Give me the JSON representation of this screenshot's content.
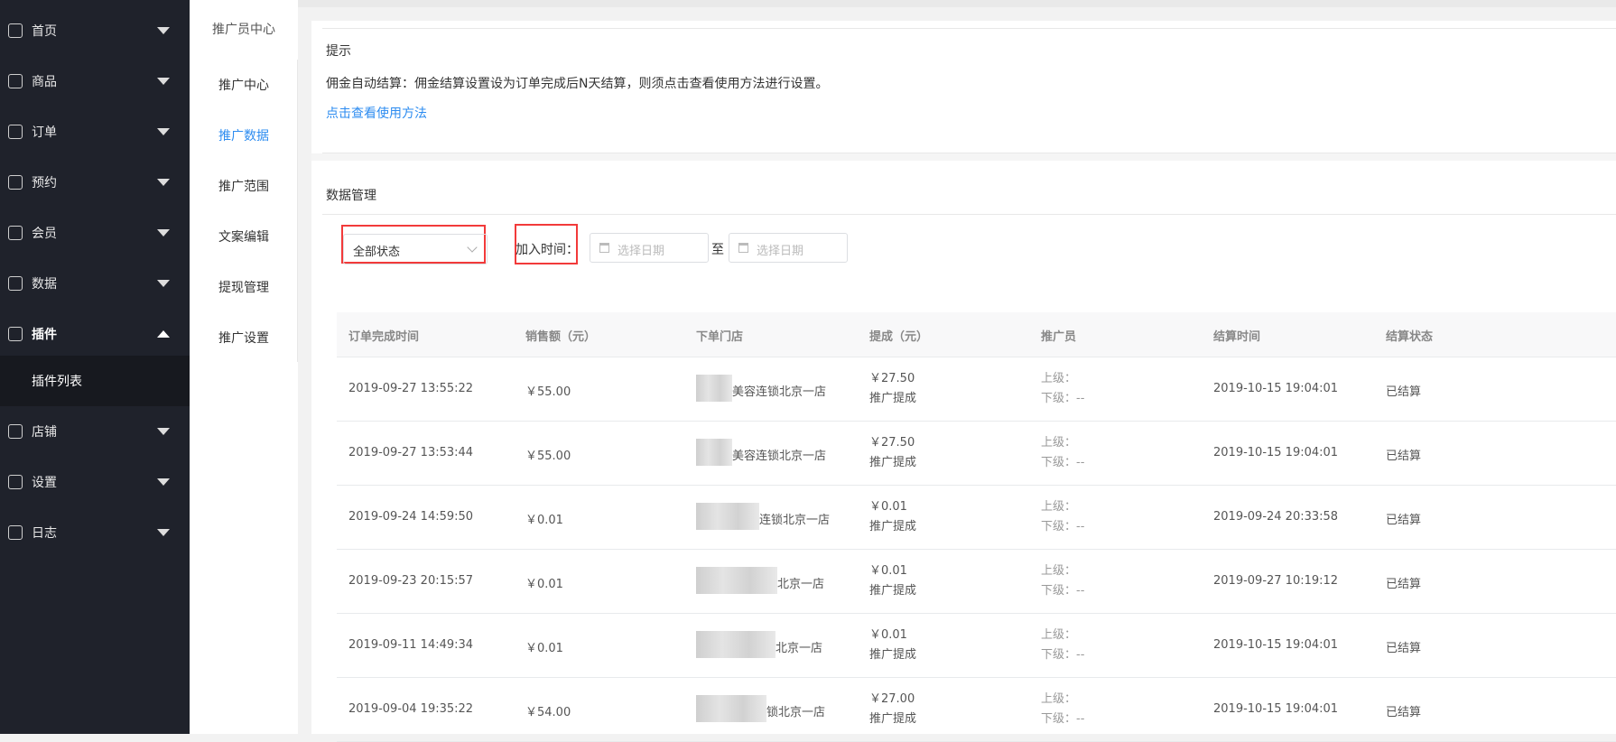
{
  "sidebar": {
    "items": [
      {
        "label": "首页",
        "icon": "dashboard-icon"
      },
      {
        "label": "商品",
        "icon": "document-icon"
      },
      {
        "label": "订单",
        "icon": "clipboard-icon"
      },
      {
        "label": "预约",
        "icon": "home-icon"
      },
      {
        "label": "会员",
        "icon": "user-icon"
      },
      {
        "label": "数据",
        "icon": "flag-icon"
      },
      {
        "label": "插件",
        "icon": "cube-icon"
      },
      {
        "label": "店铺",
        "icon": "flag-icon"
      },
      {
        "label": "设置",
        "icon": "gear-icon"
      },
      {
        "label": "日志",
        "icon": "clipboard-icon"
      }
    ],
    "sub_item": "插件列表"
  },
  "subnav": {
    "title": "推广员中心",
    "items": [
      "推广中心",
      "推广数据",
      "推广范围",
      "文案编辑",
      "提现管理",
      "推广设置"
    ],
    "active": "推广数据"
  },
  "hint": {
    "title": "提示",
    "text": "佣金自动结算：佣金结算设置设为订单完成后N天结算，则须点击查看使用方法进行设置。",
    "link": "点击查看使用方法"
  },
  "data_mgmt": {
    "title": "数据管理",
    "status_select": "全部状态",
    "join_time_label": "加入时间：",
    "date_placeholder": "选择日期",
    "to": "至"
  },
  "table": {
    "headers": [
      "订单完成时间",
      "销售额（元）",
      "下单门店",
      "提成（元）",
      "推广员",
      "结算时间",
      "结算状态"
    ],
    "rows": [
      {
        "time": "2019-09-27 13:55:22",
        "sales": "￥55.00",
        "store": "美容连锁北京一店",
        "commission": "￥27.50",
        "commission_type": "推广提成",
        "upper": "上级：",
        "lower": "下级：--",
        "settle_time": "2019-10-15 19:04:01",
        "status": "已结算"
      },
      {
        "time": "2019-09-27 13:53:44",
        "sales": "￥55.00",
        "store": "美容连锁北京一店",
        "commission": "￥27.50",
        "commission_type": "推广提成",
        "upper": "上级：",
        "lower": "下级：--",
        "settle_time": "2019-10-15 19:04:01",
        "status": "已结算"
      },
      {
        "time": "2019-09-24 14:59:50",
        "sales": "￥0.01",
        "store": "连锁北京一店",
        "commission": "￥0.01",
        "commission_type": "推广提成",
        "upper": "上级：",
        "lower": "下级：--",
        "settle_time": "2019-09-24 20:33:58",
        "status": "已结算"
      },
      {
        "time": "2019-09-23 20:15:57",
        "sales": "￥0.01",
        "store": "北京一店",
        "commission": "￥0.01",
        "commission_type": "推广提成",
        "upper": "上级：",
        "lower": "下级：--",
        "settle_time": "2019-09-27 10:19:12",
        "status": "已结算"
      },
      {
        "time": "2019-09-11 14:49:34",
        "sales": "￥0.01",
        "store": "北京一店",
        "commission": "￥0.01",
        "commission_type": "推广提成",
        "upper": "上级：",
        "lower": "下级：--",
        "settle_time": "2019-10-15 19:04:01",
        "status": "已结算"
      },
      {
        "time": "2019-09-04 19:35:22",
        "sales": "￥54.00",
        "store": "锁北京一店",
        "commission": "￥27.00",
        "commission_type": "推广提成",
        "upper": "上级：",
        "lower": "下级：--",
        "settle_time": "2019-10-15 19:04:01",
        "status": "已结算"
      }
    ]
  }
}
